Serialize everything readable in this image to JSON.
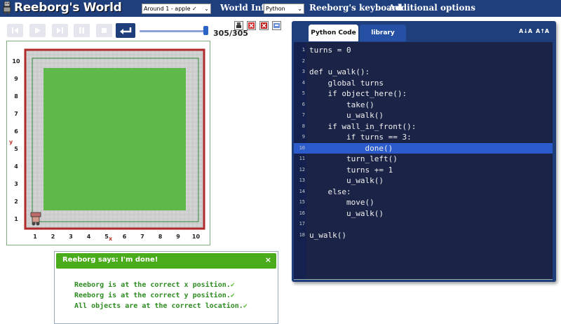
{
  "app": {
    "title": "Reeborg's World",
    "world_select": "Around 1 - apple ✓",
    "world_info": "World Info",
    "language_select": "Python",
    "keyboard": "Reeborg's keyboard",
    "additional_options": "Additional options"
  },
  "controls": {
    "step_display": "305/305",
    "slider_fraction": 1.0,
    "icons": [
      "reload-icon",
      "play-icon",
      "step-icon",
      "pause-icon",
      "stop-icon",
      "return-icon"
    ]
  },
  "world": {
    "x_ticks": [
      "1",
      "2",
      "3",
      "4",
      "5",
      "6",
      "7",
      "8",
      "9",
      "10"
    ],
    "y_ticks": [
      "1",
      "2",
      "3",
      "4",
      "5",
      "6",
      "7",
      "8",
      "9",
      "10"
    ],
    "x_axis_label": "x",
    "y_axis_label": "y"
  },
  "editor": {
    "tabs": [
      "Python Code",
      "library"
    ],
    "font_buttons": [
      "A↓A",
      "A↑A"
    ],
    "active_line": 10,
    "lines": [
      {
        "n": "1",
        "text": "turns = 0"
      },
      {
        "n": "2",
        "text": ""
      },
      {
        "n": "3",
        "text": "def u_walk():"
      },
      {
        "n": "4",
        "text": "    global turns"
      },
      {
        "n": "5",
        "text": "    if object_here():"
      },
      {
        "n": "6",
        "text": "        take()"
      },
      {
        "n": "7",
        "text": "        u_walk()"
      },
      {
        "n": "8",
        "text": "    if wall_in_front():"
      },
      {
        "n": "9",
        "text": "        if turns == 3:"
      },
      {
        "n": "10",
        "text": "            done()"
      },
      {
        "n": "11",
        "text": "        turn_left()"
      },
      {
        "n": "12",
        "text": "        turns += 1"
      },
      {
        "n": "13",
        "text": "        u_walk()"
      },
      {
        "n": "14",
        "text": "    else:"
      },
      {
        "n": "15",
        "text": "        move()"
      },
      {
        "n": "16",
        "text": "        u_walk()"
      },
      {
        "n": "17",
        "text": ""
      },
      {
        "n": "18",
        "text": "u_walk()"
      }
    ]
  },
  "dialog": {
    "title": "Reeborg says: I'm done!",
    "close": "×",
    "messages": [
      "Reeborg is at the correct x position.",
      "Reeborg is at the correct y position.",
      "All objects are at the correct location."
    ]
  },
  "colors": {
    "topbar": "#1e3e7c",
    "grass": "#5fb84a",
    "wall": "#b02a2a",
    "dialog_header": "#4aac1a",
    "success_text": "#2e8b22"
  }
}
